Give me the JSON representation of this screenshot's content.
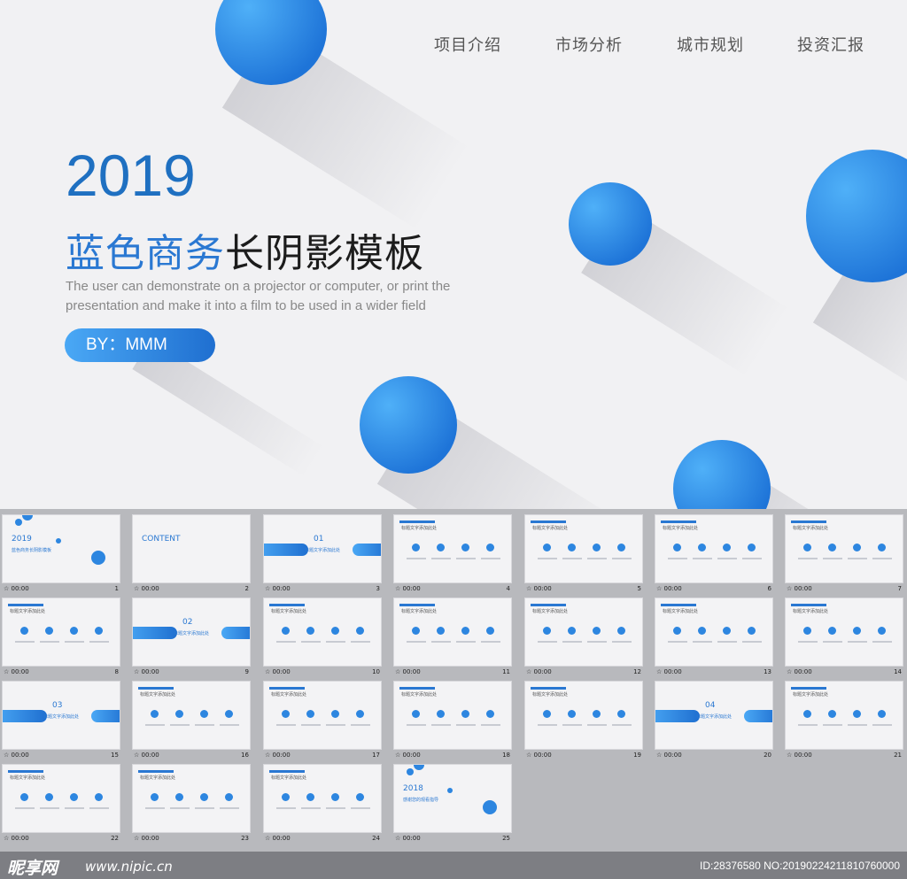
{
  "nav": [
    "项目介绍",
    "市场分析",
    "城市规划",
    "投资汇报"
  ],
  "hero": {
    "year": "2019",
    "title_blue": "蓝色商务",
    "title_black": "长阴影模板",
    "subtitle_line1": "The user can demonstrate  on a projector or computer, or print the",
    "subtitle_line2": "presentation  and make it into a film to be used in a wider field",
    "by": "BY：MMM"
  },
  "thumbnails": [
    {
      "time": "00:00",
      "num": "1",
      "label": "2019",
      "sub": "蓝色商务长阴影模板"
    },
    {
      "time": "00:00",
      "num": "2",
      "label": "CONTENT"
    },
    {
      "time": "00:00",
      "num": "3",
      "label": "01",
      "sub": "标题文字添加此处"
    },
    {
      "time": "00:00",
      "num": "4",
      "sub": "标题文字添加此处"
    },
    {
      "time": "00:00",
      "num": "5",
      "sub": "标题文字添加此处"
    },
    {
      "time": "00:00",
      "num": "6",
      "sub": "标题文字添加此处"
    },
    {
      "time": "00:00",
      "num": "7",
      "sub": "标题文字添加此处"
    },
    {
      "time": "00:00",
      "num": "8",
      "sub": "标题文字添加此处"
    },
    {
      "time": "00:00",
      "num": "9",
      "label": "02",
      "sub": "标题文字添加此处"
    },
    {
      "time": "00:00",
      "num": "10",
      "sub": "标题文字添加此处"
    },
    {
      "time": "00:00",
      "num": "11",
      "sub": "标题文字添加此处"
    },
    {
      "time": "00:00",
      "num": "12",
      "sub": "标题文字添加此处"
    },
    {
      "time": "00:00",
      "num": "13",
      "sub": "标题文字添加此处"
    },
    {
      "time": "00:00",
      "num": "14",
      "sub": "标题文字添加此处"
    },
    {
      "time": "00:00",
      "num": "15",
      "label": "03",
      "sub": "标题文字添加此处"
    },
    {
      "time": "00:00",
      "num": "16",
      "sub": "标题文字添加此处"
    },
    {
      "time": "00:00",
      "num": "17",
      "sub": "标题文字添加此处"
    },
    {
      "time": "00:00",
      "num": "18",
      "sub": "标题文字添加此处"
    },
    {
      "time": "00:00",
      "num": "19",
      "sub": "标题文字添加此处"
    },
    {
      "time": "00:00",
      "num": "20",
      "label": "04",
      "sub": "标题文字添加此处"
    },
    {
      "time": "00:00",
      "num": "21",
      "sub": "标题文字添加此处"
    },
    {
      "time": "00:00",
      "num": "22",
      "sub": "标题文字添加此处"
    },
    {
      "time": "00:00",
      "num": "23",
      "sub": "标题文字添加此处"
    },
    {
      "time": "00:00",
      "num": "24",
      "sub": "标题文字添加此处"
    },
    {
      "time": "00:00",
      "num": "25",
      "label": "2018",
      "sub": "感谢您的观看指导"
    }
  ],
  "watermark": {
    "logo": "昵享网",
    "url": "www.nipic.cn",
    "id": "ID:28376580 NO:20190224211810760000"
  },
  "colors": {
    "accent": "#2a78d2",
    "background": "#f1f1f3",
    "grid_bg": "#b8b9bd"
  }
}
